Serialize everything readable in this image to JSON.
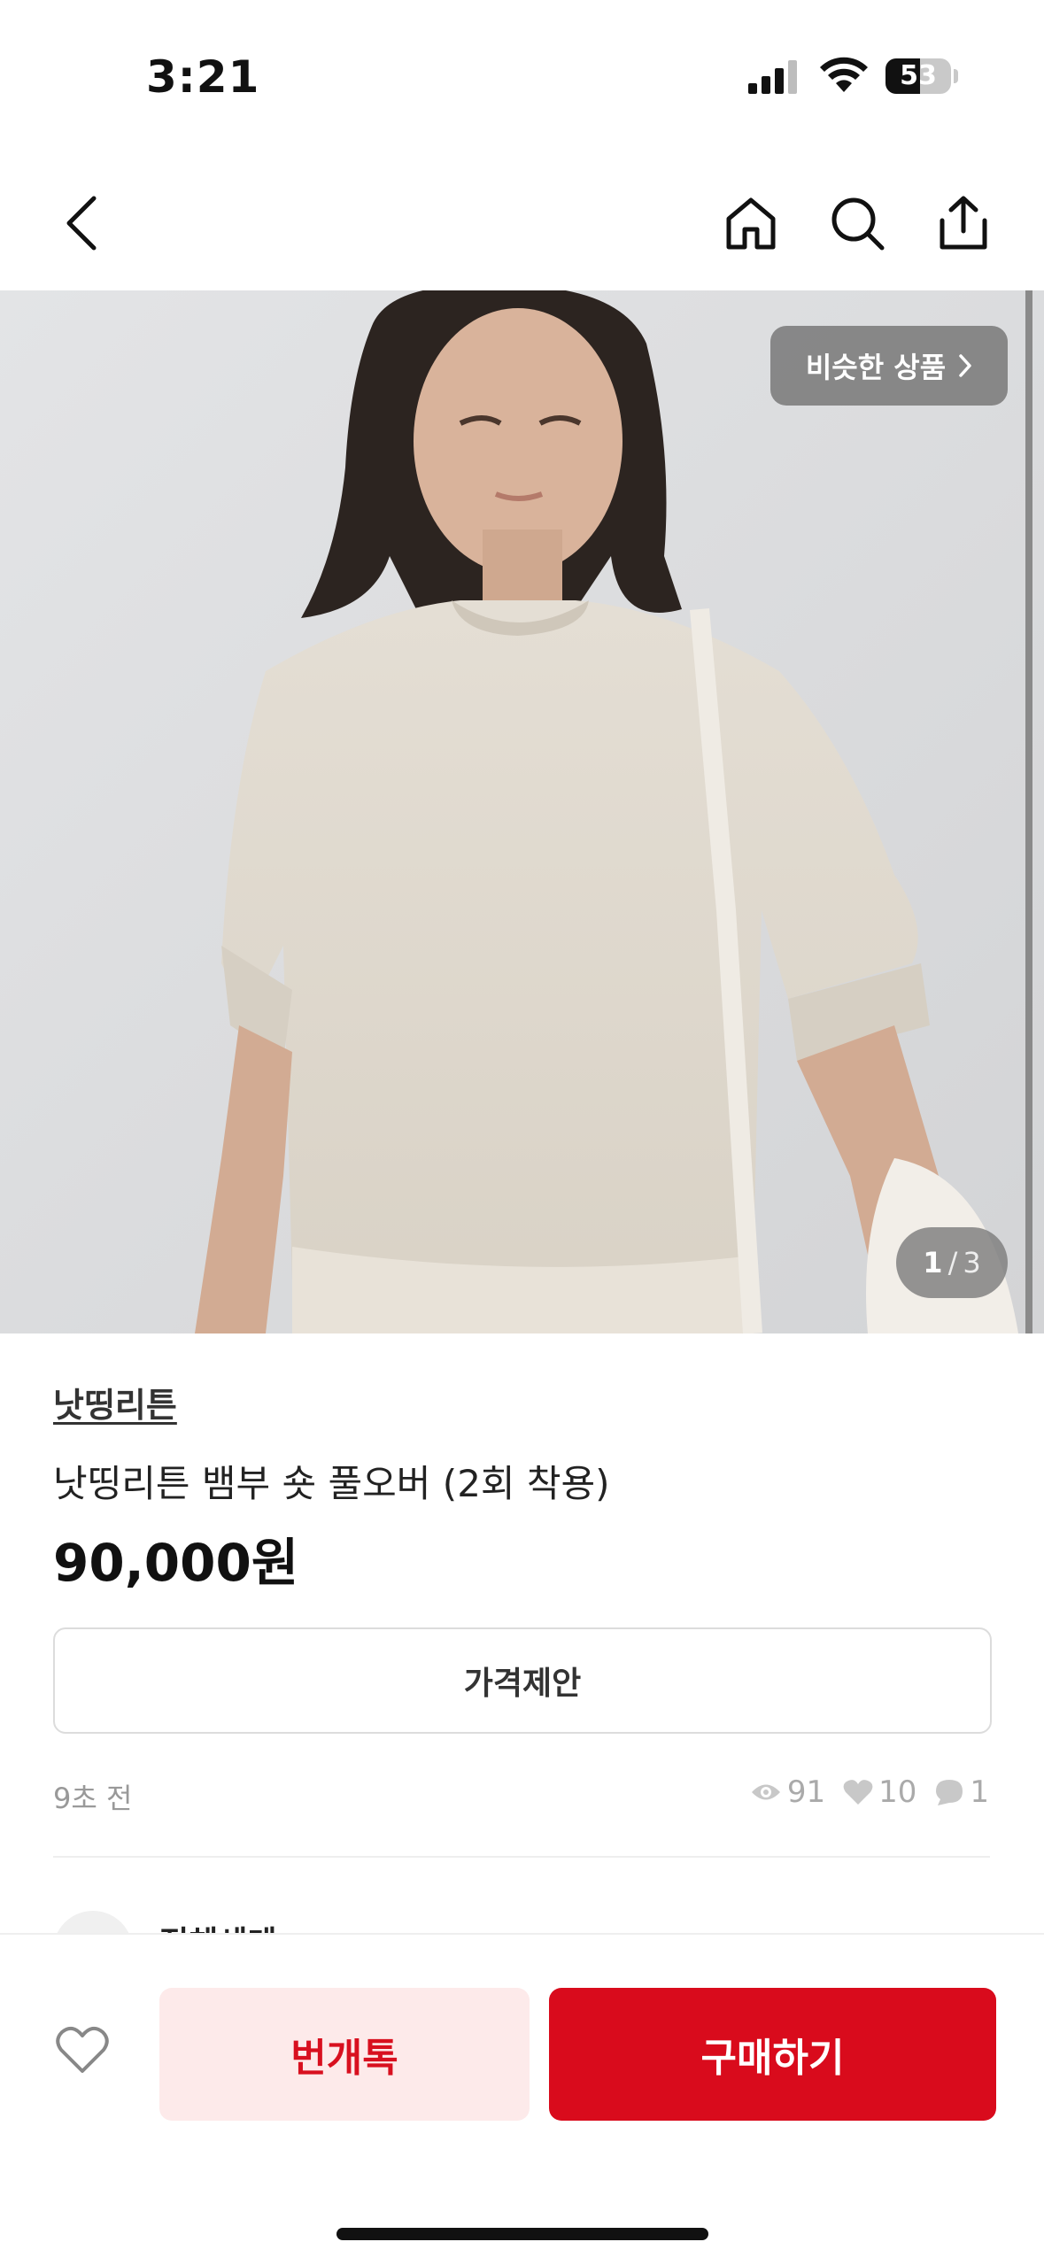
{
  "status_bar": {
    "time": "3:21",
    "battery": "53",
    "battery_level": 0.53
  },
  "nav": {
    "back": "back-icon",
    "home": "home-icon",
    "search": "search-icon",
    "share": "share-icon"
  },
  "hero": {
    "similar_label": "비슷한 상품",
    "counter_current": "1",
    "counter_sep": "/",
    "counter_total": "3"
  },
  "product": {
    "shop": "낫띵리튼",
    "title": "낫띵리튼 뱀부 숏 풀오버 (2회 착용)",
    "price": "90,000원",
    "offer_label": "가격제안",
    "time_ago": "9초 전",
    "views": "91",
    "likes": "10",
    "chats": "1"
  },
  "seller": {
    "name": "전체세계"
  },
  "actions": {
    "chat_label": "번개톡",
    "buy_label": "구매하기"
  },
  "colors": {
    "accent": "#d90b1c",
    "chat_bg": "#fdeaea"
  }
}
